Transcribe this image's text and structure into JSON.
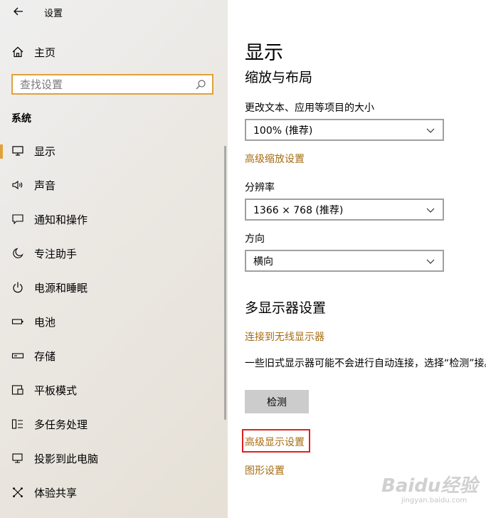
{
  "window": {
    "title": "设置"
  },
  "sidebar": {
    "home_label": "主页",
    "search": {
      "placeholder": "查找设置"
    },
    "section_title": "系统",
    "items": [
      {
        "label": "显示",
        "icon": "monitor-icon",
        "active": true
      },
      {
        "label": "声音",
        "icon": "speaker-icon"
      },
      {
        "label": "通知和操作",
        "icon": "message-icon"
      },
      {
        "label": "专注助手",
        "icon": "moon-icon"
      },
      {
        "label": "电源和睡眠",
        "icon": "power-icon"
      },
      {
        "label": "电池",
        "icon": "battery-icon"
      },
      {
        "label": "存储",
        "icon": "storage-icon"
      },
      {
        "label": "平板模式",
        "icon": "tablet-icon"
      },
      {
        "label": "多任务处理",
        "icon": "multitask-icon"
      },
      {
        "label": "投影到此电脑",
        "icon": "project-icon"
      },
      {
        "label": "体验共享",
        "icon": "share-icon"
      }
    ]
  },
  "main": {
    "page_title": "显示",
    "scale_section": "缩放与布局",
    "text_size_label": "更改文本、应用等项目的大小",
    "text_size_value": "100% (推荐)",
    "advanced_scaling_link": "高级缩放设置",
    "resolution_label": "分辨率",
    "resolution_value": "1366 × 768 (推荐)",
    "orientation_label": "方向",
    "orientation_value": "横向",
    "multi_display_section": "多显示器设置",
    "connect_wireless_link": "连接到无线显示器",
    "legacy_text": "一些旧式显示器可能不会进行自动连接，选择“检测”接。",
    "detect_button": "检测",
    "advanced_display_link": "高级显示设置",
    "graphics_link": "图形设置"
  },
  "watermark": {
    "text": "Baidu经验",
    "sub": "jingyan.baidu.com"
  },
  "colors": {
    "accent": "#e1a13a",
    "link": "#a76c12",
    "highlight_box": "#e02020",
    "button_bg": "#cccccc"
  }
}
